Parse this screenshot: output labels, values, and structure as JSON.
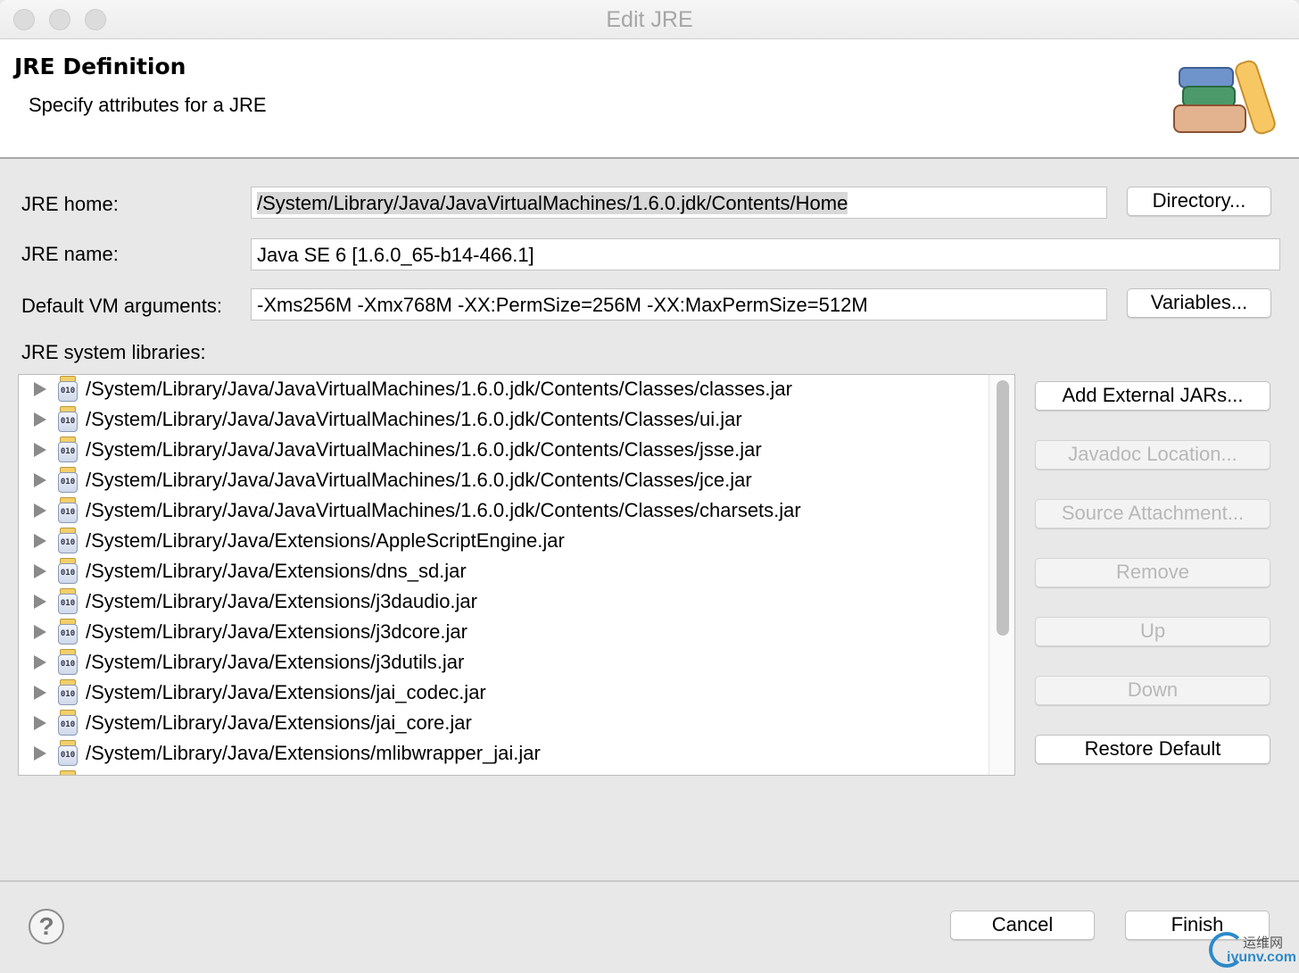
{
  "window": {
    "title": "Edit JRE"
  },
  "header": {
    "title": "JRE Definition",
    "subtitle": "Specify attributes for a JRE"
  },
  "form": {
    "jre_home_label": "JRE home:",
    "jre_home_value": "/System/Library/Java/JavaVirtualMachines/1.6.0.jdk/Contents/Home",
    "jre_name_label": "JRE name:",
    "jre_name_value": "Java SE 6 [1.6.0_65-b14-466.1]",
    "vm_args_label": "Default VM arguments:",
    "vm_args_value": "-Xms256M -Xmx768M -XX:PermSize=256M -XX:MaxPermSize=512M",
    "libraries_label": "JRE system libraries:",
    "directory_button": "Directory...",
    "variables_button": "Variables..."
  },
  "libraries": [
    {
      "path": "/System/Library/Java/JavaVirtualMachines/1.6.0.jdk/Contents/Classes/classes.jar"
    },
    {
      "path": "/System/Library/Java/JavaVirtualMachines/1.6.0.jdk/Contents/Classes/ui.jar"
    },
    {
      "path": "/System/Library/Java/JavaVirtualMachines/1.6.0.jdk/Contents/Classes/jsse.jar"
    },
    {
      "path": "/System/Library/Java/JavaVirtualMachines/1.6.0.jdk/Contents/Classes/jce.jar"
    },
    {
      "path": "/System/Library/Java/JavaVirtualMachines/1.6.0.jdk/Contents/Classes/charsets.jar"
    },
    {
      "path": "/System/Library/Java/Extensions/AppleScriptEngine.jar"
    },
    {
      "path": "/System/Library/Java/Extensions/dns_sd.jar"
    },
    {
      "path": "/System/Library/Java/Extensions/j3daudio.jar"
    },
    {
      "path": "/System/Library/Java/Extensions/j3dcore.jar"
    },
    {
      "path": "/System/Library/Java/Extensions/j3dutils.jar"
    },
    {
      "path": "/System/Library/Java/Extensions/jai_codec.jar"
    },
    {
      "path": "/System/Library/Java/Extensions/jai_core.jar"
    },
    {
      "path": "/System/Library/Java/Extensions/mlibwrapper_jai.jar"
    }
  ],
  "jar_icon_text": "010",
  "side_buttons": [
    {
      "label": "Add External JARs...",
      "enabled": true
    },
    {
      "label": "Javadoc Location...",
      "enabled": false
    },
    {
      "label": "Source Attachment...",
      "enabled": false
    },
    {
      "label": "Remove",
      "enabled": false
    },
    {
      "label": "Up",
      "enabled": false
    },
    {
      "label": "Down",
      "enabled": false
    },
    {
      "label": "Restore Default",
      "enabled": true
    }
  ],
  "footer": {
    "help": "?",
    "cancel": "Cancel",
    "finish": "Finish"
  },
  "watermark": {
    "line1": "运维网",
    "line2": "iyunv.com"
  }
}
